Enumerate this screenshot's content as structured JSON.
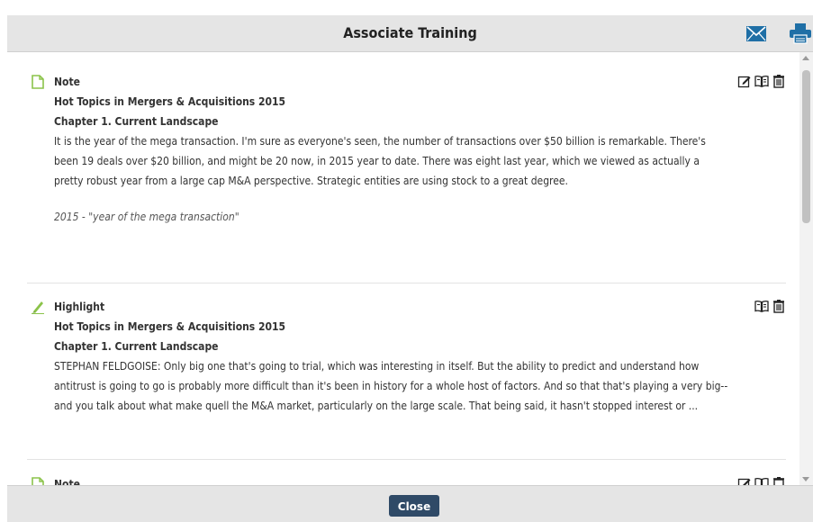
{
  "dialog": {
    "title": "Associate Training",
    "email_icon": "envelope-icon",
    "print_icon": "printer-icon",
    "close_label": "Close"
  },
  "colors": {
    "header_bg": "#e5e5e5",
    "accent_icon": "#1f6fa6",
    "note_icon": "#8bc34a",
    "close_button": "#2f4a67"
  },
  "entries": [
    {
      "type": "Note",
      "type_icon": "note-page-icon",
      "book": "Hot Topics in Mergers & Acquisitions 2015",
      "chapter": "Chapter 1. Current Landscape",
      "text_lines": [
        "It is the year of the mega transaction. I'm sure as everyone's seen, the number of transactions over $50 billion is remarkable. There's",
        "been 19 deals over $20 billion, and might be 20 now, in 2015 year to date. There was eight last year, which we viewed as actually a",
        "pretty robust year from a large cap M&A perspective. Strategic entities are using stock to a great degree."
      ],
      "comment": "2015 - \"year of the mega transaction\"",
      "actions": [
        "edit-icon",
        "open-book-icon",
        "trash-icon"
      ]
    },
    {
      "type": "Highlight",
      "type_icon": "highlighter-pen-icon",
      "book": "Hot Topics in Mergers & Acquisitions 2015",
      "chapter": "Chapter 1. Current Landscape",
      "text_lines": [
        "STEPHAN FELDGOISE: Only big one that's going to trial, which was interesting in itself. But the ability to predict and understand how",
        "antitrust is going to go is probably more difficult than it's been in history for a whole host of factors. And so that that's playing a very big--",
        "and you talk about what make quell the M&A market, particularly on the large scale. That being said, it hasn't stopped interest or ..."
      ],
      "actions": [
        "open-book-icon",
        "trash-icon"
      ]
    },
    {
      "type": "Note",
      "type_icon": "note-page-icon",
      "actions": [
        "edit-icon",
        "open-book-icon",
        "trash-icon"
      ]
    }
  ]
}
